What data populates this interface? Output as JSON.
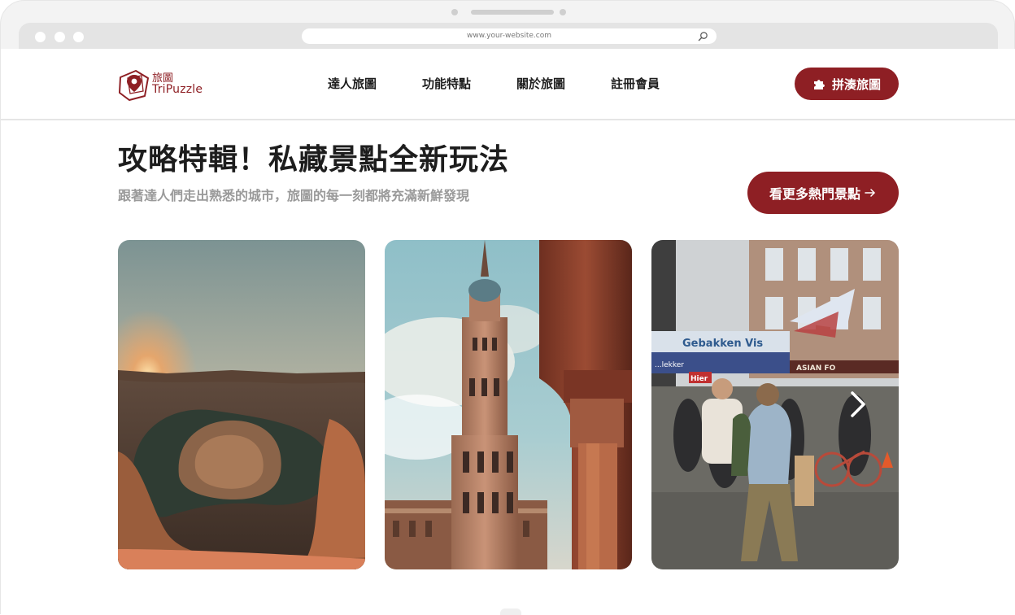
{
  "browser": {
    "url": "www.your-website.com"
  },
  "brand": {
    "name_zh": "旅圖",
    "name_en": "TriPuzzle",
    "primary_color": "#8e1f24"
  },
  "nav": {
    "items": [
      {
        "label": "達人旅圖"
      },
      {
        "label": "功能特點"
      },
      {
        "label": "關於旅圖"
      },
      {
        "label": "註冊會員"
      }
    ],
    "cta_label": "拼湊旅圖",
    "cta_icon": "puzzle-icon"
  },
  "hero": {
    "title": "攻略特輯！私藏景點全新玩法",
    "subtitle": "跟著達人們走出熟悉的城市，旅圖的每一刻都將充滿新鮮發現",
    "more_label": "看更多熱門景點",
    "more_icon": "arrow-right-icon"
  },
  "cards": [
    {
      "scene": "canyon-river-bend-at-sunset"
    },
    {
      "scene": "ornate-spanish-tower"
    },
    {
      "scene": "busy-city-street-market",
      "sign_1": "Gebakken Vis",
      "sign_2": "ASIAN FO",
      "sign_3": "Hier",
      "sign_4": "...lekker"
    }
  ],
  "carousel": {
    "next_icon": "chevron-right-icon"
  }
}
